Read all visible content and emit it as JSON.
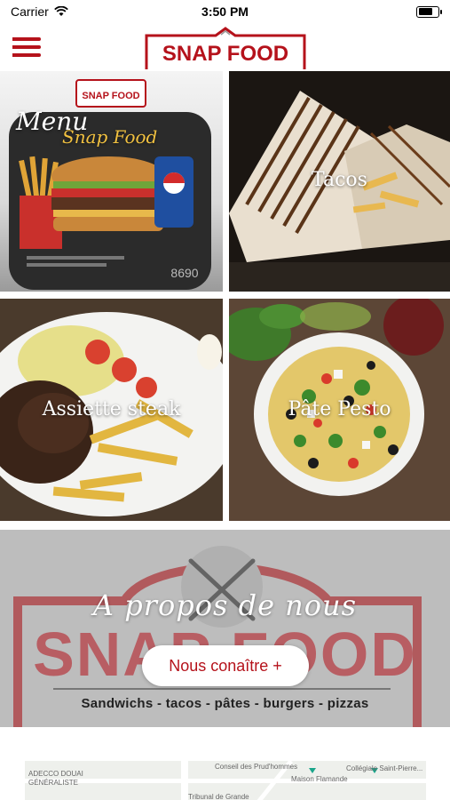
{
  "status_bar": {
    "carrier": "Carrier",
    "time": "3:50 PM",
    "battery_level": 0.75
  },
  "header": {
    "logo_text": "SNAP FOOD",
    "menu_icon": "hamburger-menu-icon",
    "accent_color": "#b5121b"
  },
  "tiles": [
    {
      "id": "menu",
      "label": "Menu",
      "subtitle": "Snap Food",
      "logo_text": "SNAP FOOD",
      "price": "8690"
    },
    {
      "id": "tacos",
      "label": "Tacos"
    },
    {
      "id": "steak",
      "label": "Assiette steak"
    },
    {
      "id": "pesto",
      "label": "Pâte Pesto"
    }
  ],
  "about": {
    "title": "A propos de nous",
    "button_label": "Nous conaître +",
    "brand_text": "SNAP FOOD",
    "tagline": "Sandwichs - tacos - pâtes - burgers - pizzas"
  },
  "map": {
    "labels": [
      "ADECCO DOUAI",
      "GÉNÉRALISTE",
      "Tribunal de Grande",
      "Conseil des Prud'hommes",
      "Maison Flamande",
      "Collégiale Saint-Pierre..."
    ]
  }
}
